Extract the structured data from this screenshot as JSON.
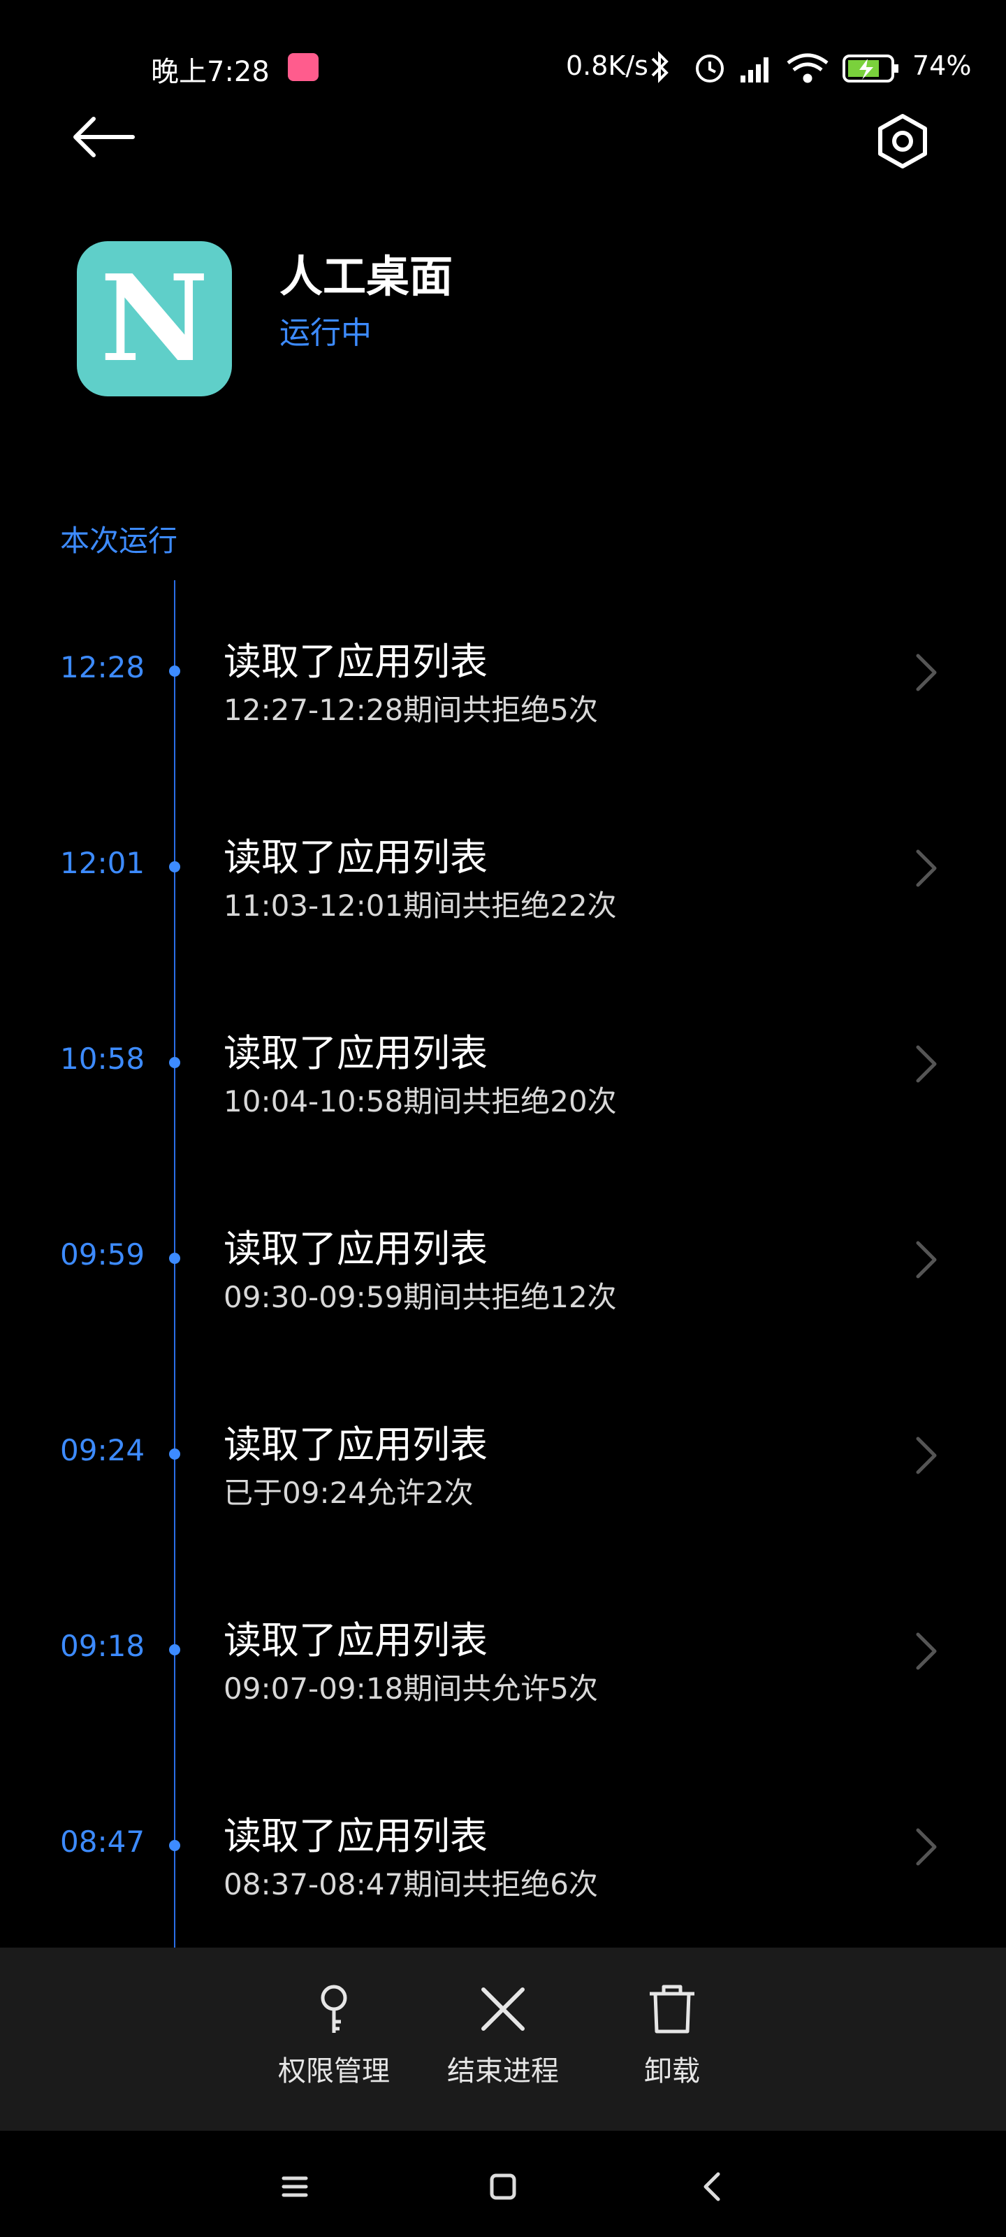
{
  "status_bar": {
    "time": "晚上7:28",
    "net_speed": "0.8K/s",
    "battery_percent": "74%",
    "icons": [
      "bilibili-badge-icon",
      "bluetooth-icon",
      "alarm-icon",
      "hd-signal-icon",
      "wifi-icon",
      "battery-charging-icon"
    ]
  },
  "app": {
    "icon_letter": "N",
    "name": "人工桌面",
    "status": "运行中"
  },
  "section_title": "本次运行",
  "events": [
    {
      "time": "12:28",
      "title": "读取了应用列表",
      "detail": "12:27-12:28期间共拒绝5次"
    },
    {
      "time": "12:01",
      "title": "读取了应用列表",
      "detail": "11:03-12:01期间共拒绝22次"
    },
    {
      "time": "10:58",
      "title": "读取了应用列表",
      "detail": "10:04-10:58期间共拒绝20次"
    },
    {
      "time": "09:59",
      "title": "读取了应用列表",
      "detail": "09:30-09:59期间共拒绝12次"
    },
    {
      "time": "09:24",
      "title": "读取了应用列表",
      "detail": "已于09:24允许2次"
    },
    {
      "time": "09:18",
      "title": "读取了应用列表",
      "detail": "09:07-09:18期间共允许5次"
    },
    {
      "time": "08:47",
      "title": "读取了应用列表",
      "detail": "08:37-08:47期间共拒绝6次"
    }
  ],
  "actions": {
    "permissions": "权限管理",
    "end_process": "结束进程",
    "uninstall": "卸载"
  },
  "colors": {
    "accent": "#3d8bff",
    "app_icon_bg": "#5fcfc9",
    "action_bar_bg": "#1b1b1b"
  }
}
